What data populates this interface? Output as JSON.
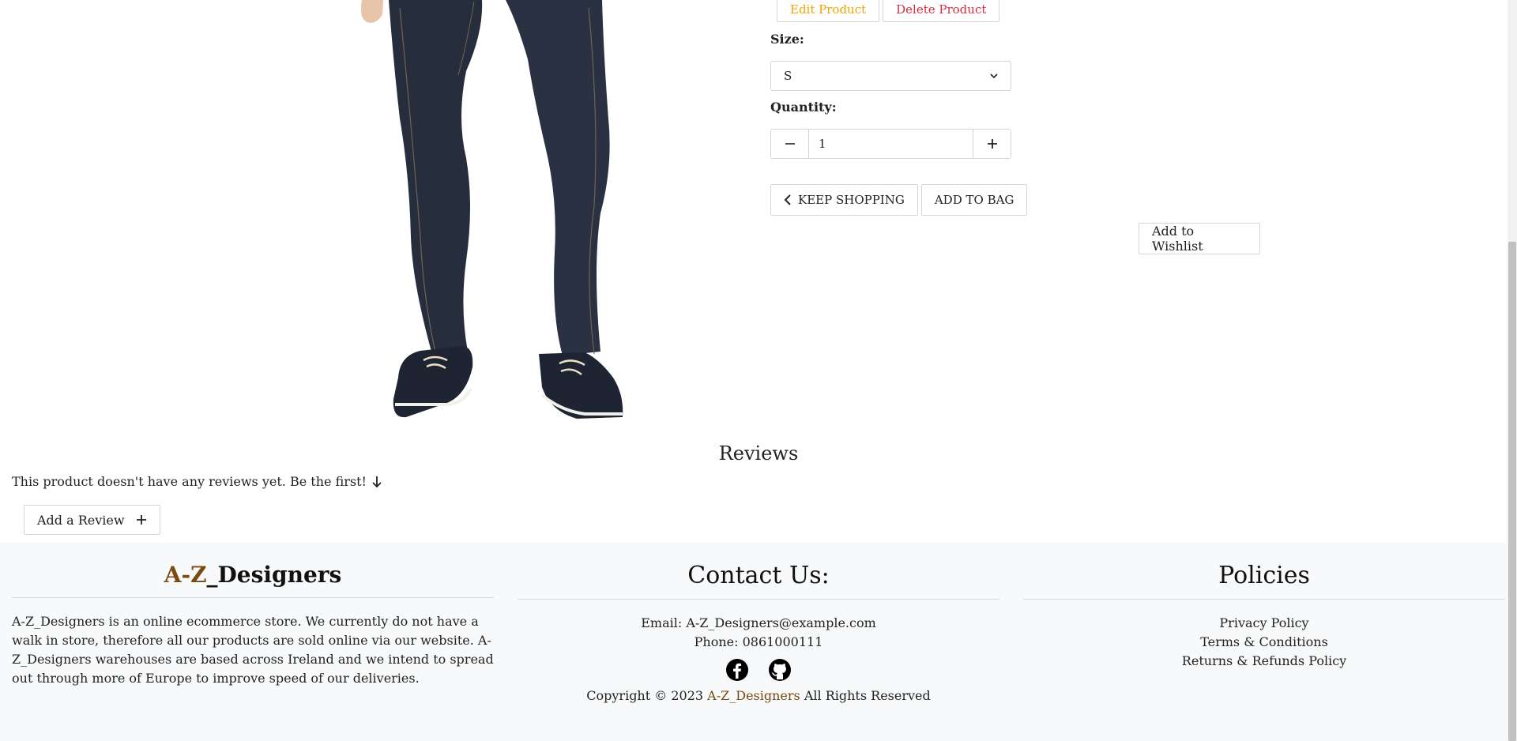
{
  "product": {
    "admin": {
      "edit_label": "Edit Product",
      "delete_label": "Delete Product"
    },
    "size_label": "Size:",
    "size_selected": "S",
    "quantity_label": "Quantity:",
    "quantity_value": "1",
    "keep_shopping_label": "KEEP SHOPPING",
    "add_to_bag_label": "ADD TO BAG",
    "wishlist_label": "Add to Wishlist"
  },
  "reviews": {
    "title": "Reviews",
    "empty_text": "This product doesn't have any reviews yet. Be the first!",
    "add_label": "Add a Review"
  },
  "footer": {
    "brand": {
      "title_prefix": "A-Z",
      "title_suffix": "_Designers",
      "description": "A-Z_Designers is an online ecommerce store. We currently do not have a walk in store, therefore all our products are sold online via our website. A-Z_Designers warehouses are based across Ireland and we intend to spread out through more of Europe to improve speed of our deliveries."
    },
    "contact": {
      "title": "Contact Us:",
      "email": "Email: A-Z_Designers@example.com",
      "phone": "Phone: 0861000111",
      "copyright_prefix": "Copyright © 2023",
      "copyright_brand": "A-Z_Designers",
      "copyright_suffix": "All Rights Reserved"
    },
    "policies": {
      "title": "Policies",
      "links": [
        "Privacy Policy",
        "Terms & Conditions",
        "Returns & Refunds Policy"
      ]
    }
  },
  "colors": {
    "edit": "#f0a500",
    "delete": "#d32f3f",
    "brand_accent": "#7a4a12",
    "footer_bg": "#f8f9fa"
  },
  "icons": [
    "chevron-left-icon",
    "minus-icon",
    "plus-icon",
    "arrow-down-icon",
    "facebook-icon",
    "github-icon",
    "chevron-down-icon"
  ]
}
